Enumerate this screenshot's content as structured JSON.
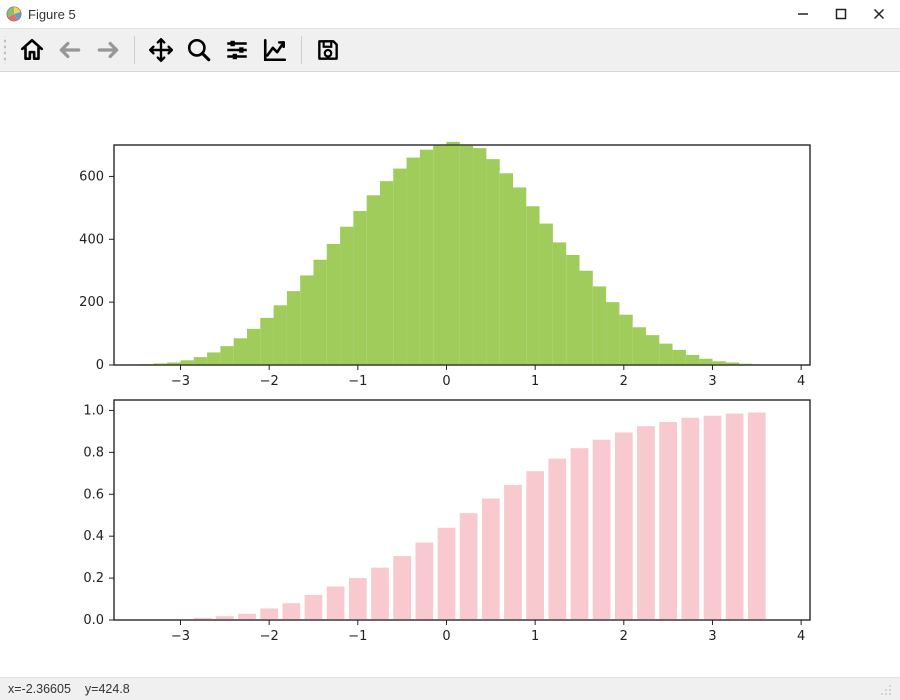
{
  "window": {
    "title": "Figure 5"
  },
  "toolbar": {
    "home": "Home",
    "back": "Back",
    "forward": "Forward",
    "pan": "Pan",
    "zoom": "Zoom",
    "subplots": "Configure subplots",
    "axes": "Edit axis",
    "save": "Save"
  },
  "status": {
    "x_label": "x=-2.36605",
    "y_label": "y=424.8"
  },
  "chart_data": [
    {
      "type": "bar",
      "title": "",
      "xlabel": "",
      "ylabel": "",
      "xlim": [
        -3.75,
        4.1
      ],
      "ylim": [
        0,
        700
      ],
      "xticks": [
        -3,
        -2,
        -1,
        0,
        1,
        2,
        3,
        4
      ],
      "yticks": [
        0,
        200,
        400,
        600
      ],
      "color": "#9fcc5a",
      "bin_edges": [
        -3.75,
        -3.6,
        -3.45,
        -3.3,
        -3.15,
        -3.0,
        -2.85,
        -2.7,
        -2.55,
        -2.4,
        -2.25,
        -2.1,
        -1.95,
        -1.8,
        -1.65,
        -1.5,
        -1.35,
        -1.2,
        -1.05,
        -0.9,
        -0.75,
        -0.6,
        -0.45,
        -0.3,
        -0.15,
        0.0,
        0.15,
        0.3,
        0.45,
        0.6,
        0.75,
        0.9,
        1.05,
        1.2,
        1.35,
        1.5,
        1.65,
        1.8,
        1.95,
        2.1,
        2.25,
        2.4,
        2.55,
        2.7,
        2.85,
        3.0,
        3.15,
        3.3,
        3.45,
        3.6,
        3.75,
        3.9,
        4.05
      ],
      "values": [
        1,
        2,
        3,
        5,
        8,
        15,
        25,
        40,
        60,
        85,
        115,
        150,
        190,
        235,
        285,
        335,
        385,
        440,
        490,
        540,
        585,
        625,
        660,
        685,
        700,
        710,
        700,
        690,
        655,
        610,
        565,
        505,
        450,
        390,
        350,
        300,
        250,
        200,
        160,
        120,
        95,
        68,
        48,
        32,
        20,
        12,
        8,
        4,
        2,
        1,
        1,
        1
      ]
    },
    {
      "type": "bar",
      "title": "",
      "xlabel": "",
      "ylabel": "",
      "xlim": [
        -3.75,
        4.1
      ],
      "ylim": [
        0,
        1.05
      ],
      "xticks": [
        -3,
        -2,
        -1,
        0,
        1,
        2,
        3,
        4
      ],
      "yticks": [
        0.0,
        0.2,
        0.4,
        0.6,
        0.8,
        1.0
      ],
      "color": "#f8c9cf",
      "categories": [
        -3.5,
        -3.0,
        -2.5,
        -2.0,
        -1.5,
        -1.0,
        -0.5,
        0.0,
        0.5,
        1.0,
        1.5,
        2.0,
        2.5,
        3.0,
        3.5
      ],
      "values": [
        0.0005,
        0.003,
        0.01,
        0.03,
        0.06,
        0.12,
        0.2,
        0.305,
        0.44,
        0.58,
        0.71,
        0.82,
        0.895,
        0.945,
        0.975,
        0.99,
        0.995,
        1.0,
        1.0,
        1.0,
        1.0,
        1.0,
        1.0,
        1.0,
        1.0,
        1.0,
        1.0,
        1.0
      ],
      "bar_x": [
        -3.5,
        -3.25,
        -3.0,
        -2.75,
        -2.5,
        -2.25,
        -2.0,
        -1.75,
        -1.5,
        -1.25,
        -1.0,
        -0.75,
        -0.5,
        -0.25,
        0.0,
        0.25,
        0.5,
        0.75,
        1.0,
        1.25,
        1.5,
        1.75,
        2.0,
        2.25,
        2.5,
        2.75,
        3.0,
        3.25,
        3.5
      ],
      "bar_values": [
        0.0005,
        0.002,
        0.005,
        0.01,
        0.018,
        0.03,
        0.055,
        0.08,
        0.12,
        0.16,
        0.2,
        0.25,
        0.305,
        0.37,
        0.44,
        0.51,
        0.58,
        0.645,
        0.71,
        0.77,
        0.82,
        0.86,
        0.895,
        0.925,
        0.945,
        0.965,
        0.975,
        0.985,
        0.99
      ]
    }
  ]
}
